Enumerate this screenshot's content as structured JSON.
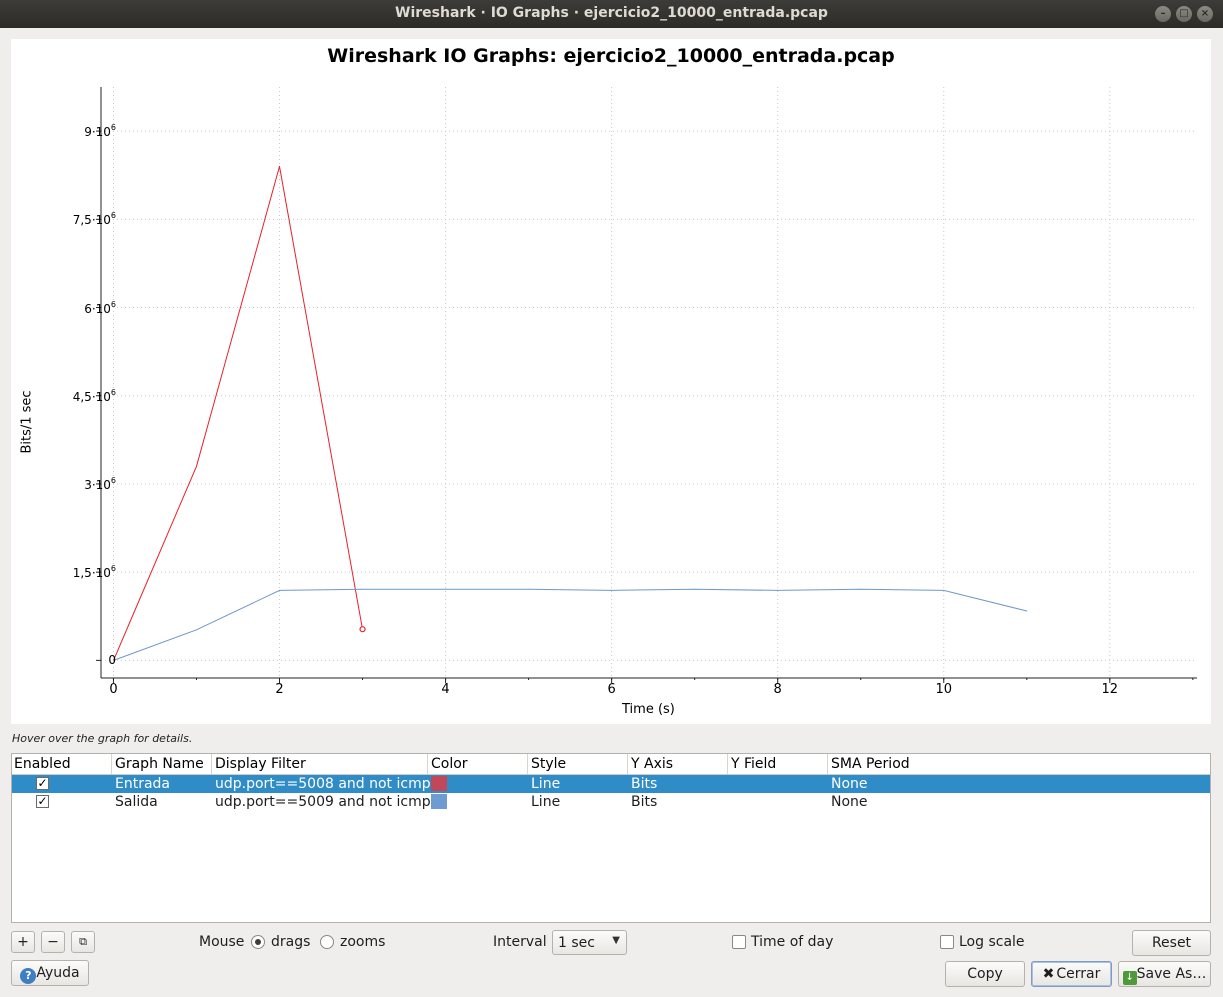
{
  "window": {
    "title": "Wireshark · IO Graphs · ejercicio2_10000_entrada.pcap"
  },
  "chart_data": {
    "type": "line",
    "title": "Wireshark IO Graphs: ejercicio2_10000_entrada.pcap",
    "xlabel": "Time (s)",
    "ylabel": "Bits/1 sec",
    "xlim": [
      -0.15,
      13.05
    ],
    "ylim": [
      -300000,
      9750000
    ],
    "x_ticks": [
      "0",
      "2",
      "4",
      "6",
      "8",
      "10",
      "12"
    ],
    "y_ticks": [
      {
        "mantissa": "0",
        "exp": ""
      },
      {
        "mantissa": "1,5·10",
        "exp": "6"
      },
      {
        "mantissa": "3·10",
        "exp": "6"
      },
      {
        "mantissa": "4,5·10",
        "exp": "6"
      },
      {
        "mantissa": "6·10",
        "exp": "6"
      },
      {
        "mantissa": "7,5·10",
        "exp": "6"
      },
      {
        "mantissa": "9·10",
        "exp": "6"
      }
    ],
    "y_tick_values": [
      0,
      1500000,
      3000000,
      4500000,
      6000000,
      7500000,
      9000000
    ],
    "grid": true,
    "series": [
      {
        "name": "Entrada",
        "color": "#e8202a",
        "x": [
          0,
          1,
          2,
          3
        ],
        "y": [
          0,
          3300000,
          8400000,
          530000
        ]
      },
      {
        "name": "Salida",
        "color": "#6f98c9",
        "x": [
          0,
          1,
          2,
          3,
          4,
          5,
          6,
          7,
          8,
          9,
          10,
          11
        ],
        "y": [
          0,
          520000,
          1190000,
          1210000,
          1210000,
          1210000,
          1190000,
          1210000,
          1190000,
          1210000,
          1190000,
          840000
        ]
      }
    ]
  },
  "hint": "Hover over the graph for details.",
  "table": {
    "headers": [
      "Enabled",
      "Graph Name",
      "Display Filter",
      "Color",
      "Style",
      "Y Axis",
      "Y Field",
      "SMA Period"
    ],
    "rows": [
      {
        "enabled": "✓",
        "name": "Entrada",
        "filter": "udp.port==5008 and not icmp",
        "color": "#c0485a",
        "style": "Line",
        "yaxis": "Bits",
        "yfield": "",
        "sma": "None"
      },
      {
        "enabled": "✓",
        "name": "Salida",
        "filter": "udp.port==5009 and not icmp",
        "color": "#6f9bd3",
        "style": "Line",
        "yaxis": "Bits",
        "yfield": "",
        "sma": "None"
      }
    ]
  },
  "controls": {
    "add": "+",
    "remove": "−",
    "copy_graph": "⧉",
    "mouse_label": "Mouse",
    "drags": "drags",
    "zooms": "zooms",
    "interval_label": "Interval",
    "interval_value": "1 sec",
    "time_of_day": "Time of day",
    "log_scale": "Log scale",
    "reset": "Reset",
    "help": "Ayuda",
    "copy": "Copy",
    "close": "Cerrar",
    "save_as": "Save As…"
  }
}
